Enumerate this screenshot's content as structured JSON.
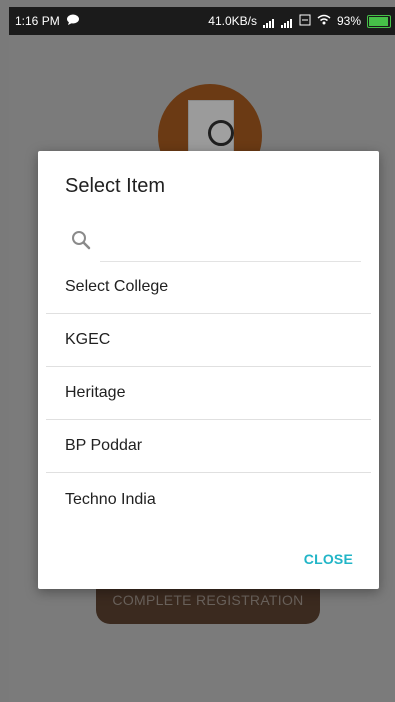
{
  "status_bar": {
    "time": "1:16 PM",
    "speed": "41.0KB/s",
    "battery_percent": "93%",
    "battery_level": 0.93
  },
  "screen": {
    "complete_registration_label": "COMPLETE REGISTRATION"
  },
  "dialog": {
    "title": "Select Item",
    "search_placeholder": "",
    "items": [
      "Select College",
      "KGEC",
      "Heritage",
      "BP Poddar",
      "Techno India"
    ],
    "close_label": "CLOSE"
  },
  "colors": {
    "accent": "#21b5c7",
    "logo_bg": "#6b3a14",
    "button_bg": "#3b2a1f"
  }
}
